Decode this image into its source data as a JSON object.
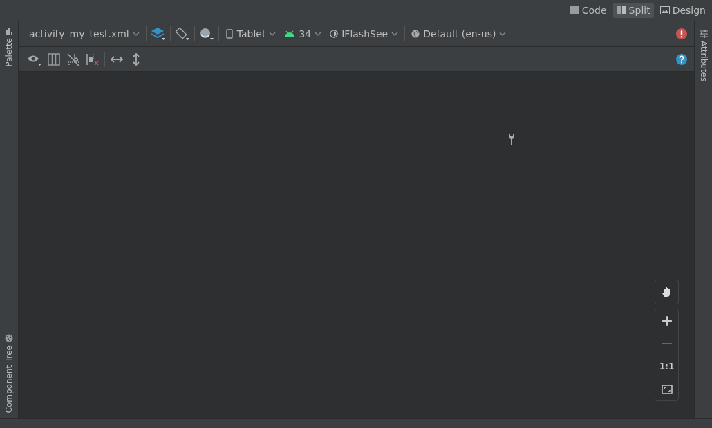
{
  "view_modes": [
    {
      "label": "Code",
      "kind": "code",
      "selected": false
    },
    {
      "label": "Split",
      "kind": "split",
      "selected": true
    },
    {
      "label": "Design",
      "kind": "design",
      "selected": false
    }
  ],
  "toolbar": {
    "file": "activity_my_test.xml",
    "device": "Tablet",
    "api_level": "34",
    "theme": "IFlashSee",
    "locale": "Default (en-us)"
  },
  "left_tabs": [
    {
      "label": "Palette",
      "kind": "palette"
    },
    {
      "label": "Component Tree",
      "kind": "tree"
    }
  ],
  "right_tabs": [
    {
      "label": "Attributes"
    }
  ],
  "zoom_controls": {
    "actual_size": "1:1"
  }
}
